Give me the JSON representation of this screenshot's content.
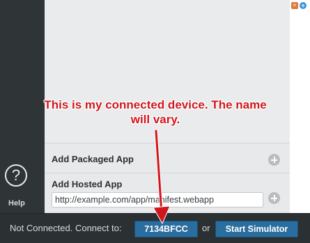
{
  "sidebar": {
    "help_label": "Help",
    "help_icon": "question-circle-icon"
  },
  "apps": {
    "packaged_label": "Add Packaged App",
    "hosted_label": "Add Hosted App",
    "hosted_url_value": "http://example.com/app/manifest.webapp"
  },
  "statusbar": {
    "status_text": "Not Connected. Connect to:",
    "device_button_label": "7134BFCC",
    "or_text": "or",
    "simulator_button_label": "Start Simulator"
  },
  "corner": {
    "close_glyph": "×",
    "plus_glyph": "+"
  },
  "annotation": {
    "text": "This is my connected device. The name will vary."
  },
  "colors": {
    "annotation_red": "#d0161c",
    "button_blue": "#2a6e9f",
    "sidebar_dark": "#2f3437"
  }
}
